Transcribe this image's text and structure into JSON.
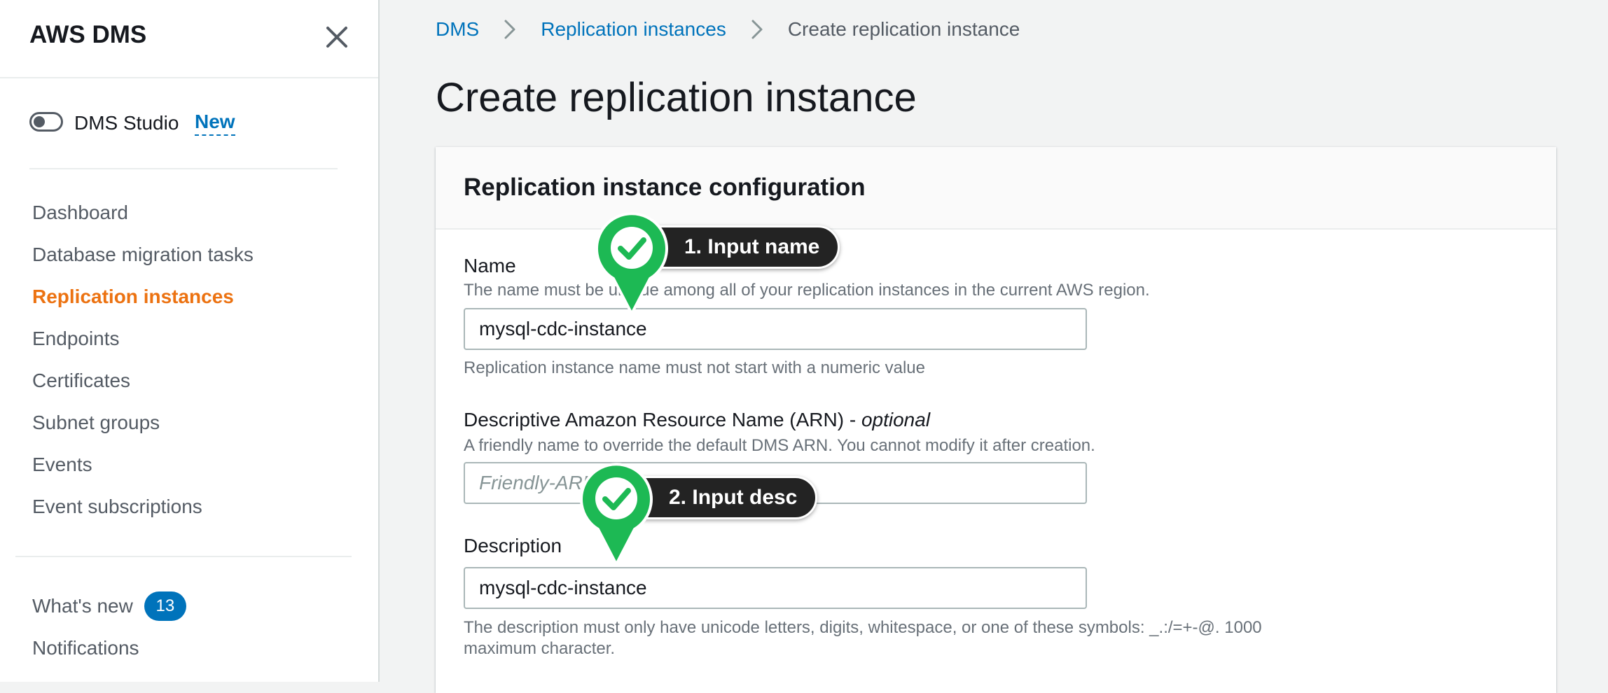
{
  "sidebar": {
    "title": "AWS DMS",
    "studio_label": "DMS Studio",
    "studio_new": "New",
    "nav": [
      {
        "label": "Dashboard"
      },
      {
        "label": "Database migration tasks"
      },
      {
        "label": "Replication instances"
      },
      {
        "label": "Endpoints"
      },
      {
        "label": "Certificates"
      },
      {
        "label": "Subnet groups"
      },
      {
        "label": "Events"
      },
      {
        "label": "Event subscriptions"
      }
    ],
    "whats_new_label": "What's new",
    "whats_new_count": "13",
    "notifications_label": "Notifications"
  },
  "breadcrumb": {
    "root": "DMS",
    "parent": "Replication instances",
    "current": "Create replication instance"
  },
  "page_title": "Create replication instance",
  "panel": {
    "title": "Replication instance configuration",
    "name": {
      "label": "Name",
      "description": "The name must be unique among all of your replication instances in the current AWS region.",
      "value": "mysql-cdc-instance",
      "constraint": "Replication instance name must not start with a numeric value"
    },
    "arn": {
      "label": "Descriptive Amazon Resource Name (ARN) - ",
      "label_optional": "optional",
      "description": "A friendly name to override the default DMS ARN. You cannot modify it after creation.",
      "placeholder": "Friendly-ARN-name"
    },
    "description": {
      "label": "Description",
      "value": "mysql-cdc-instance",
      "constraint": "The description must only have unicode letters, digits, whitespace, or one of these symbols: _.:/=+-@. 1000 maximum character."
    }
  },
  "callouts": [
    {
      "label": "1. Input name",
      "icon": "check-icon"
    },
    {
      "label": "2. Input desc",
      "icon": "check-icon"
    }
  ],
  "colors": {
    "accent": "#0073bb",
    "active_nav": "#ec7211",
    "callout_green": "#1db954",
    "callout_dark": "#232323"
  }
}
